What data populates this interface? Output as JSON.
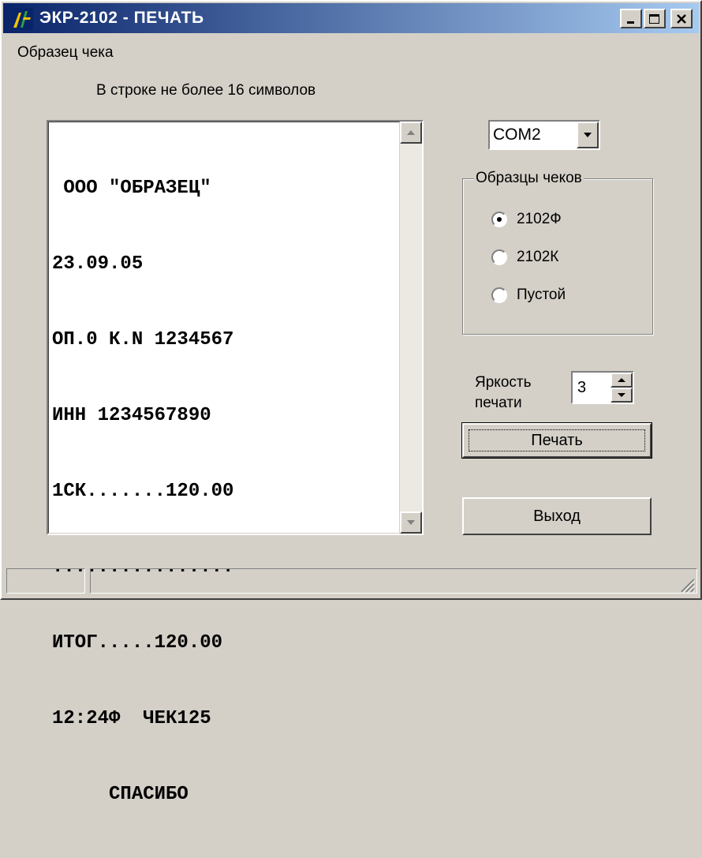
{
  "window": {
    "title": "ЭКР-2102 - ПЕЧАТЬ"
  },
  "titlebar": {
    "buttons": [
      "minimize",
      "maximize",
      "close"
    ]
  },
  "menu": {
    "items": [
      "Образец чека"
    ]
  },
  "hint": "В строке не более 16 символов",
  "receipt": {
    "lines": [
      " ООО \"ОБРАЗЕЦ\"",
      "23.09.05",
      "ОП.0 К.N 1234567",
      "ИНН 1234567890",
      "1СК.......120.00",
      "................",
      "ИТОГ.....120.00",
      "12:24Ф  ЧЕК125",
      "     СПАСИБО"
    ]
  },
  "port": {
    "value": "COM2"
  },
  "samples": {
    "legend": "Образцы чеков",
    "options": [
      {
        "label": "2102Ф",
        "checked": true
      },
      {
        "label": "2102К",
        "checked": false
      },
      {
        "label": "Пустой",
        "checked": false
      }
    ]
  },
  "brightness": {
    "label_line1": "Яркость",
    "label_line2": "печати",
    "value": "3"
  },
  "buttons": {
    "print": "Печать",
    "exit": "Выход"
  }
}
